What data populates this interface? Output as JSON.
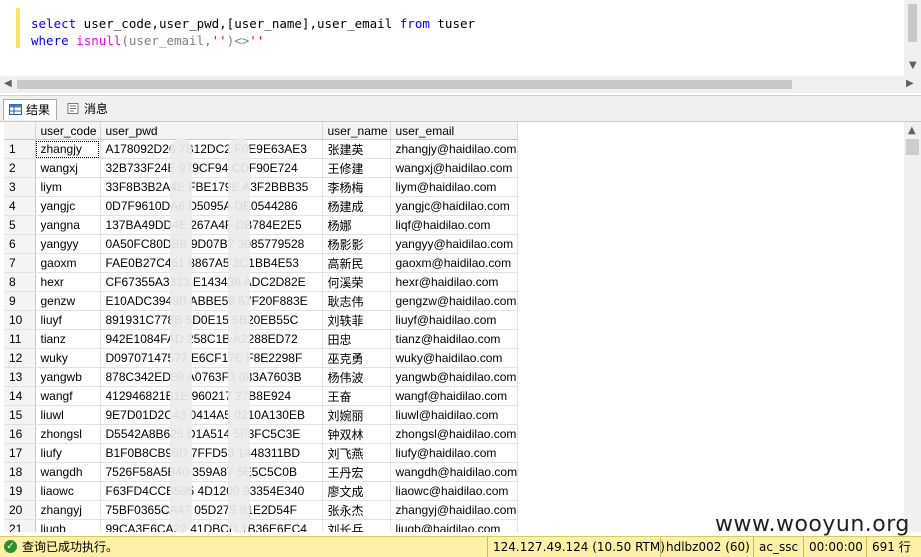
{
  "editor": {
    "line1": {
      "select": "select",
      "cols": " user_code,user_pwd,[user_name],user_email ",
      "from": "from",
      "table": " tuser"
    },
    "line2": {
      "where": "where",
      "fn": "isnull",
      "args": "(user_email,",
      "q1": "''",
      "op": ")<>",
      "q2": "''"
    }
  },
  "tabs": {
    "results": "结果",
    "messages": "消息"
  },
  "grid": {
    "columns": [
      "user_code",
      "user_pwd",
      "user_name",
      "user_email"
    ],
    "rows": [
      [
        "1",
        "zhangjy",
        "A178092D26 7B12DC2 F0E9E63AE3",
        "张建英",
        "zhangjy@haidilao.com"
      ],
      [
        "2",
        "wangxj",
        "32B733F24E 979CF94 CDF90E724",
        "王修建",
        "wangxj@haidilao.com"
      ],
      [
        "3",
        "liym",
        "33F8B3B2A4E FBE179E A3F2BBB35",
        "李杨梅",
        "liym@haidilao.com"
      ],
      [
        "4",
        "yangjc",
        "0D7F9610DA6 D5095A DE0544286",
        "杨建成",
        "yangjc@haidilao.com"
      ],
      [
        "5",
        "yangna",
        "137BA49DD4E 267A4F DB784E2E5",
        "杨娜",
        "liqf@haidilao.com"
      ],
      [
        "6",
        "yangyy",
        "0A50FC80DBB 9D07B7 3085779528",
        "杨影影",
        "yangyy@haidilao.com"
      ],
      [
        "7",
        "gaoxm",
        "FAE0B27C451 8867A5 3C1BB4E53",
        "高新民",
        "gaoxm@haidilao.com"
      ],
      [
        "8",
        "hexr",
        "CF67355A3333 E143439 ADC2D82E",
        "何溪荣",
        "hexr@haidilao.com"
      ],
      [
        "9",
        "genzw",
        "E10ADC3949B ABBE56 57F20F883E",
        "耿志伟",
        "gengzw@haidilao.com"
      ],
      [
        "10",
        "liuyf",
        "891931C778B 5D0E15 5B20EB55C",
        "刘轶菲",
        "liuyf@haidilao.com"
      ],
      [
        "11",
        "tianz",
        "942E1084FAD 258C1B A2288ED72",
        "田忠",
        "tianz@haidilao.com"
      ],
      [
        "12",
        "wuky",
        "D09707147577 E6CF17E F8E2298F",
        "巫克勇",
        "wuky@haidilao.com"
      ],
      [
        "13",
        "yangwb",
        "878C342ED89 A0763F3 083A7603B",
        "杨伟波",
        "yangwb@haidilao.com"
      ],
      [
        "14",
        "wangf",
        "412946821B1E 960217 27B8E924",
        "王奋",
        "wangf@haidilao.com"
      ],
      [
        "15",
        "liuwl",
        "9E7D01D2C43 0414A5 0210A130EB",
        "刘婉丽",
        "liuwl@haidilao.com"
      ],
      [
        "16",
        "zhongsl",
        "D5542A8B625 D1A514 5F3FC5C3E",
        "钟双林",
        "zhongsl@haidilao.com"
      ],
      [
        "17",
        "liufy",
        "B1F0B8CB95D 7FFD53 1448311BD",
        "刘飞燕",
        "liufy@haidilao.com"
      ],
      [
        "18",
        "wangdh",
        "7526F58A5B40 359A87 5E5C5C0B",
        "王丹宏",
        "wangdh@haidilao.com"
      ],
      [
        "19",
        "liaowc",
        "F63FD4CCB595 4D1200 93354E340",
        "廖文成",
        "liaowc@haidilao.com"
      ],
      [
        "20",
        "zhangyj",
        "75BF0365CA47 05D275 81E2D54F",
        "张永杰",
        "zhangyj@haidilao.com"
      ],
      [
        "21",
        "liugb",
        "99CA3E6CA27 41DBCD 1B36E6EC4",
        "刘长兵",
        "liugb@haidilao.com"
      ]
    ]
  },
  "status": {
    "message": "查询已成功执行。",
    "server": "124.127.49.124 (10.50 RTM)",
    "user": "hdlbz002 (60)",
    "database": "ac_ssc",
    "elapsed": "00:00:00",
    "rows": "691 行"
  },
  "watermark": "www.wooyun.org"
}
